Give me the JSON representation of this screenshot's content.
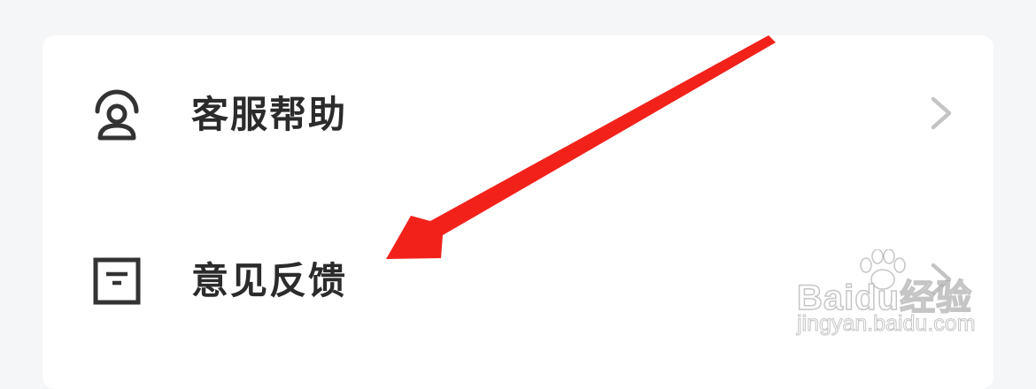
{
  "menu": {
    "items": [
      {
        "label": "客服帮助",
        "icon": "customer-service-icon"
      },
      {
        "label": "意见反馈",
        "icon": "feedback-icon"
      }
    ]
  },
  "colors": {
    "page_background": "#f5f6f7",
    "card_background": "#ffffff",
    "label_text": "#2b2b2b",
    "icon_stroke": "#333333",
    "chevron": "#c4c4c4",
    "annotation_arrow": "#f2221b"
  },
  "watermark": {
    "brand": "Bai",
    "brand_box": "du",
    "brand_suffix": "经验",
    "url": "jingyan.baidu.com"
  }
}
